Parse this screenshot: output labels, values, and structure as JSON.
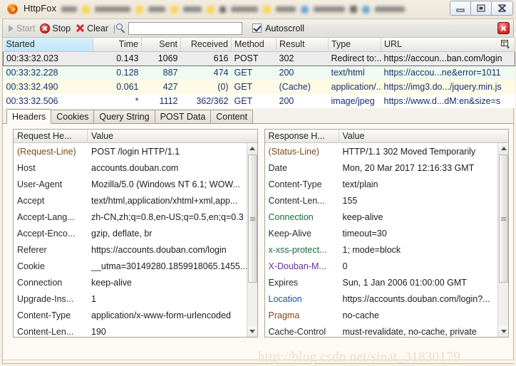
{
  "window": {
    "title": "HttpFox",
    "icon": "firefox-icon",
    "controls": [
      {
        "name": "minimize-button",
        "glyph": "minimize"
      },
      {
        "name": "maximize-button",
        "glyph": "maximize"
      },
      {
        "name": "close-button",
        "glyph": "close"
      }
    ]
  },
  "toolbar": {
    "start_label": "Start",
    "start_enabled": false,
    "stop_label": "Stop",
    "clear_label": "Clear",
    "separator": "|",
    "filter_value": "",
    "filter_placeholder": "",
    "autoscroll_label": "Autoscroll",
    "autoscroll_checked": true,
    "close_label": ""
  },
  "request_list": {
    "columns": [
      {
        "label": "Started",
        "align": "left",
        "sorted": true
      },
      {
        "label": "Time",
        "align": "right",
        "sorted": false
      },
      {
        "label": "Sent",
        "align": "right",
        "sorted": false
      },
      {
        "label": "Received",
        "align": "right",
        "sorted": false
      },
      {
        "label": "Method",
        "align": "left",
        "sorted": false
      },
      {
        "label": "Result",
        "align": "left",
        "sorted": false
      },
      {
        "label": "Type",
        "align": "left",
        "sorted": false
      },
      {
        "label": "URL",
        "align": "left",
        "sorted": false
      }
    ],
    "column_chooser_icon": "column-chooser-icon",
    "rows": [
      {
        "started": "00:33:32.023",
        "time": "0.143",
        "sent": "1069",
        "received": "616",
        "method": "POST",
        "result": "302",
        "type": "Redirect to:...",
        "url": "https://accoun...ban.com/login",
        "state": "selected"
      },
      {
        "started": "00:33:32.228",
        "time": "0.128",
        "sent": "887",
        "received": "474",
        "method": "GET",
        "result": "200",
        "type": "text/html",
        "url": "https://accou...ne&error=1011",
        "state": "green"
      },
      {
        "started": "00:33:32.490",
        "time": "0.061",
        "sent": "427",
        "received": "(0)",
        "method": "GET",
        "result": "(Cache)",
        "type": "application/...",
        "url": "https://img3.do.../jquery.min.js",
        "state": "yellow"
      },
      {
        "started": "00:33:32.506",
        "time": "*",
        "sent": "1112",
        "received": "362/362",
        "method": "GET",
        "result": "200",
        "type": "image/jpeg",
        "url": "https://www.d...dM:en&size=s",
        "state": "white"
      }
    ]
  },
  "tabs": [
    {
      "label": "Headers",
      "active": true
    },
    {
      "label": "Cookies",
      "active": false
    },
    {
      "label": "Query String",
      "active": false
    },
    {
      "label": "POST Data",
      "active": false
    },
    {
      "label": "Content",
      "active": false
    }
  ],
  "request_headers": {
    "col_key": "Request He...",
    "col_value": "Value",
    "rows": [
      {
        "key": "(Request-Line)",
        "value": "POST /login HTTP/1.1"
      },
      {
        "key": "Host",
        "value": "accounts.douban.com"
      },
      {
        "key": "User-Agent",
        "value": "Mozilla/5.0 (Windows NT 6.1; WOW..."
      },
      {
        "key": "Accept",
        "value": "text/html,application/xhtml+xml,app..."
      },
      {
        "key": "Accept-Lang...",
        "value": "zh-CN,zh;q=0.8,en-US;q=0.5,en;q=0.3"
      },
      {
        "key": "Accept-Enco...",
        "value": "gzip, deflate, br"
      },
      {
        "key": "Referer",
        "value": "https://accounts.douban.com/login"
      },
      {
        "key": "Cookie",
        "value": "__utma=30149280.1859918065.1455..."
      },
      {
        "key": "Connection",
        "value": "keep-alive"
      },
      {
        "key": "Upgrade-Ins...",
        "value": "1"
      },
      {
        "key": "Content-Type",
        "value": "application/x-www-form-urlencoded"
      },
      {
        "key": "Content-Len...",
        "value": "190"
      }
    ]
  },
  "response_headers": {
    "col_key": "Response H...",
    "col_value": "Value",
    "rows": [
      {
        "key": "(Status-Line)",
        "value": "HTTP/1.1 302 Moved Temporarily"
      },
      {
        "key": "Date",
        "value": "Mon, 20 Mar 2017 12:16:33 GMT"
      },
      {
        "key": "Content-Type",
        "value": "text/plain"
      },
      {
        "key": "Content-Len...",
        "value": "155"
      },
      {
        "key": "Connection",
        "value": "keep-alive"
      },
      {
        "key": "Keep-Alive",
        "value": "timeout=30"
      },
      {
        "key": "x-xss-protect...",
        "value": "1; mode=block"
      },
      {
        "key": "X-Douban-M...",
        "value": "0"
      },
      {
        "key": "Expires",
        "value": "Sun, 1 Jan 2006 01:00:00 GMT"
      },
      {
        "key": "Location",
        "value": "https://accounts.douban.com/login?..."
      },
      {
        "key": "Pragma",
        "value": "no-cache"
      },
      {
        "key": "Cache-Control",
        "value": "must-revalidate, no-cache, private"
      }
    ]
  },
  "watermark": "http://blog.csdn.net/sinat_31830179",
  "colors": {
    "selected_row": "#ececec",
    "row_green": "#effbf0",
    "row_yellow": "#fdfbe6",
    "sorted_header": "#bfe6fa",
    "link_text": "#1a2f6b",
    "stop_red": "#d92b2b",
    "window_bg": "#fdf6e8"
  }
}
